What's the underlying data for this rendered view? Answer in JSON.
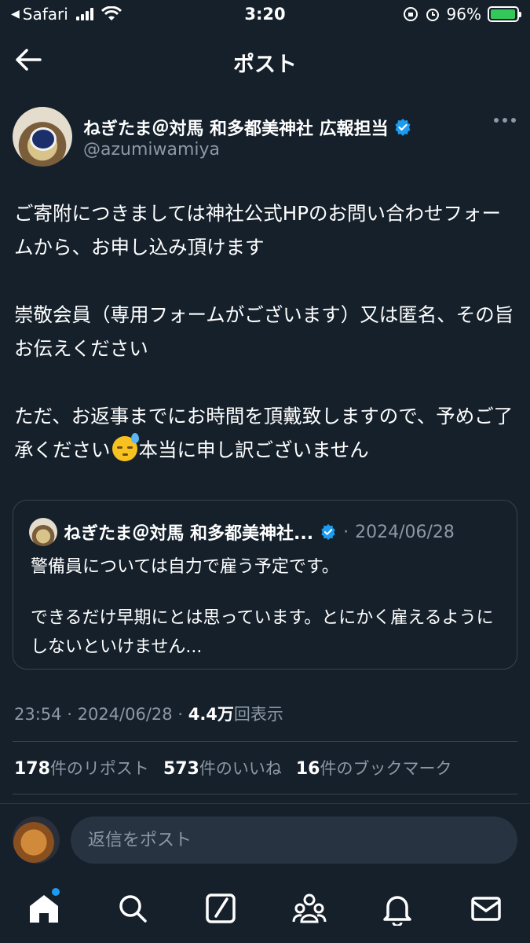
{
  "status_bar": {
    "back_app": "Safari",
    "time": "3:20",
    "battery": "96%",
    "battery_level": 0.96
  },
  "header": {
    "title": "ポスト"
  },
  "author": {
    "name": "ねぎたま＠対馬 和多都美神社 広報担当",
    "handle": "@azumiwamiya"
  },
  "tweet": {
    "paragraphs": [
      "ご寄附につきましては神社公式HPのお問い合わせフォームから、お申し込み頂けます",
      "崇敬会員（専用フォームがございます）又は匿名、その旨お伝えください"
    ],
    "para3_before_emoji": "ただ、お返事までにお時間を頂戴致しますので、予めご了承ください",
    "para3_after_emoji": "本当に申し訳ございません",
    "emoji": "downcast-face-with-sweat"
  },
  "quote": {
    "name": "ねぎたま＠対馬 和多都美神社...",
    "separator": "·",
    "date": "2024/06/28",
    "paragraphs": [
      "警備員については自力で雇う予定です。",
      "できるだけ早期にとは思っています。とにかく雇えるようにしないといけません..."
    ]
  },
  "meta": {
    "time": "23:54",
    "sep1": "·",
    "date": "2024/06/28",
    "sep2": "·",
    "views_count": "4.4万",
    "views_label": "回表示"
  },
  "stats": {
    "reposts_count": "178",
    "reposts_label": "件のリポスト",
    "likes_count": "573",
    "likes_label": "件のいいね",
    "bookmarks_count": "16",
    "bookmarks_label": "件のブックマーク"
  },
  "reply": {
    "placeholder": "返信をポスト"
  },
  "tabs": [
    "home",
    "search",
    "grok",
    "communities",
    "notifications",
    "messages"
  ],
  "colors": {
    "background": "#15202b",
    "accent": "#1d9bf0",
    "secondary_text": "#8b98a5",
    "border": "#38444d"
  }
}
